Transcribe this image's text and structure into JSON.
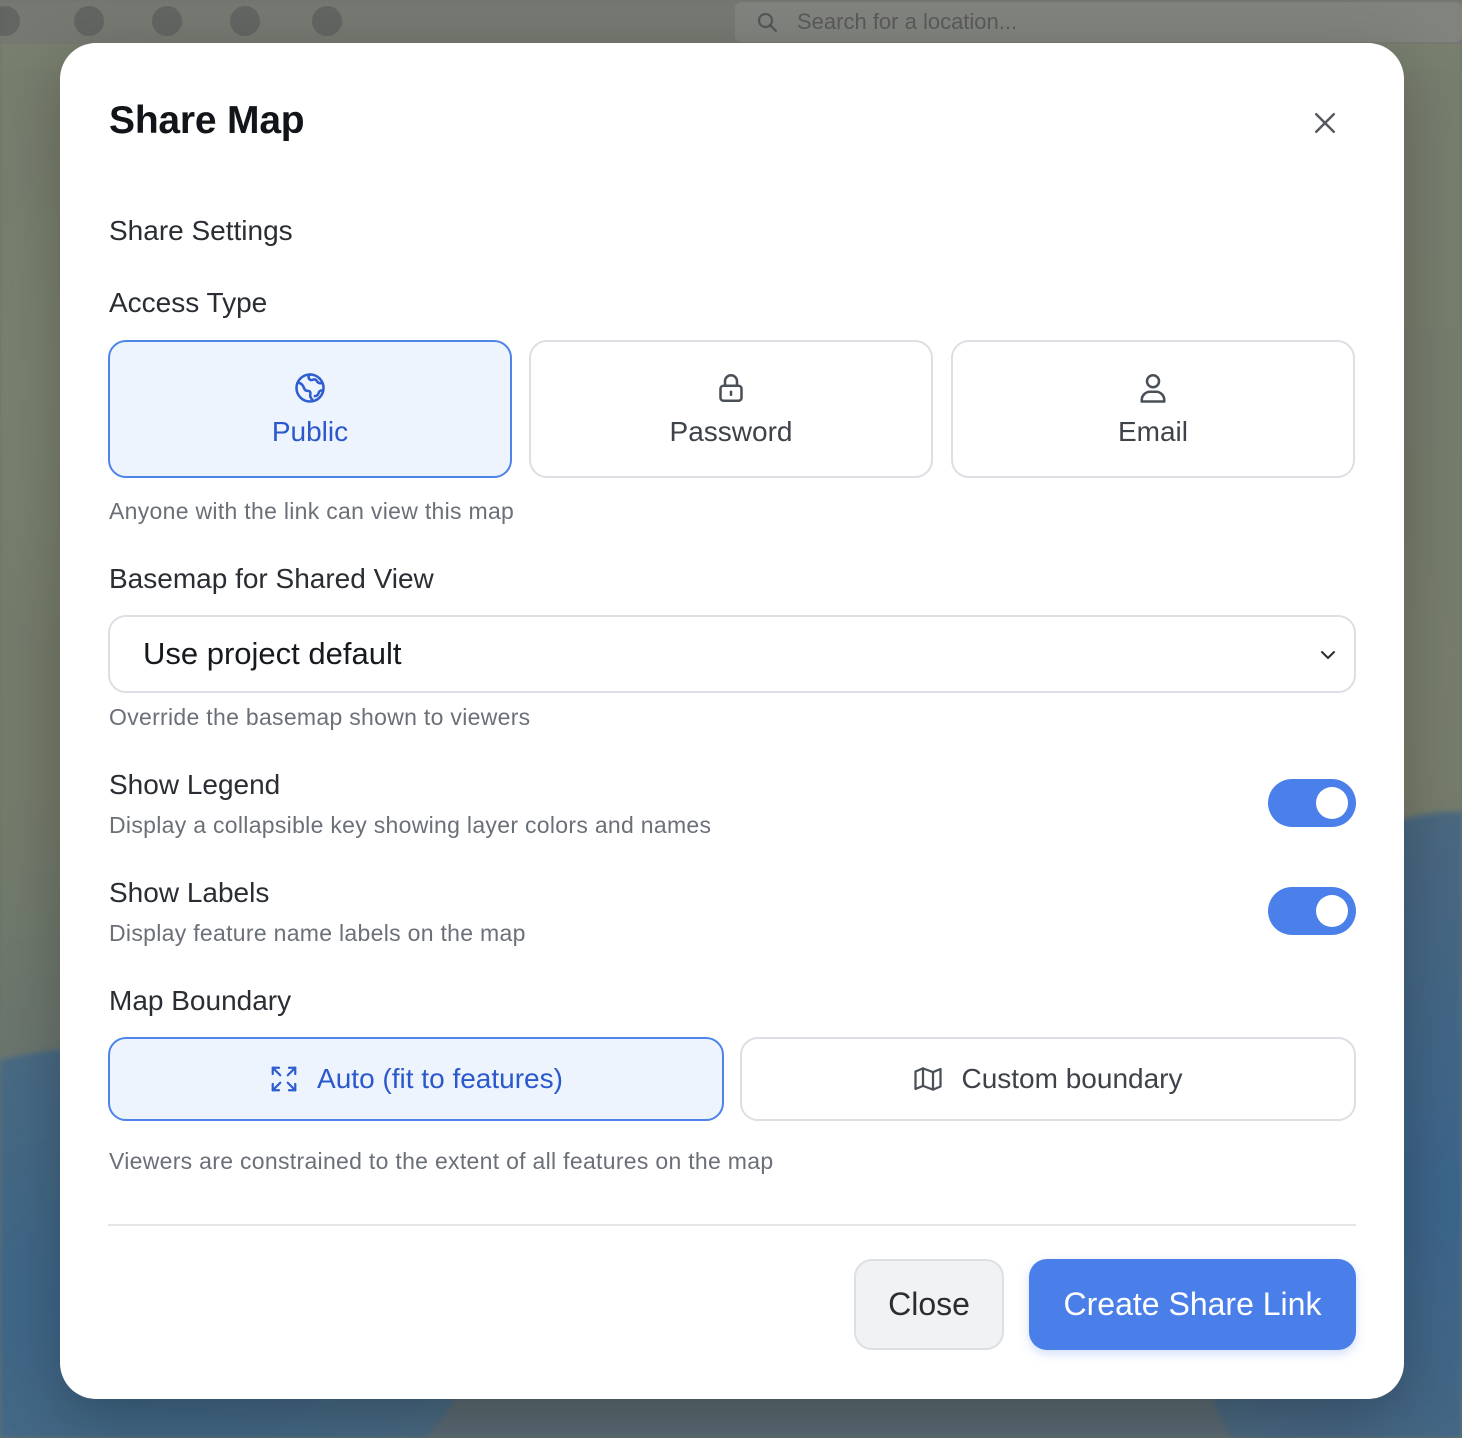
{
  "background": {
    "search_placeholder": "Search for a location..."
  },
  "modal": {
    "title": "Share Map",
    "section_title": "Share Settings",
    "access_type": {
      "label": "Access Type",
      "options": [
        {
          "label": "Public",
          "icon": "globe-icon",
          "selected": true
        },
        {
          "label": "Password",
          "icon": "lock-icon",
          "selected": false
        },
        {
          "label": "Email",
          "icon": "user-icon",
          "selected": false
        }
      ],
      "help": "Anyone with the link can view this map"
    },
    "basemap": {
      "label": "Basemap for Shared View",
      "selected": "Use project default",
      "help": "Override the basemap shown to viewers"
    },
    "show_legend": {
      "label": "Show Legend",
      "description": "Display a collapsible key showing layer colors and names",
      "enabled": true
    },
    "show_labels": {
      "label": "Show Labels",
      "description": "Display feature name labels on the map",
      "enabled": true
    },
    "map_boundary": {
      "label": "Map Boundary",
      "options": [
        {
          "label": "Auto (fit to features)",
          "icon": "expand-icon",
          "selected": true
        },
        {
          "label": "Custom boundary",
          "icon": "map-icon",
          "selected": false
        }
      ],
      "help": "Viewers are constrained to the extent of all features on the map"
    },
    "footer": {
      "close_label": "Close",
      "create_label": "Create Share Link"
    }
  },
  "colors": {
    "accent": "#4a7fea",
    "accent_text": "#2b58cc",
    "selected_bg": "#edf4fe"
  }
}
